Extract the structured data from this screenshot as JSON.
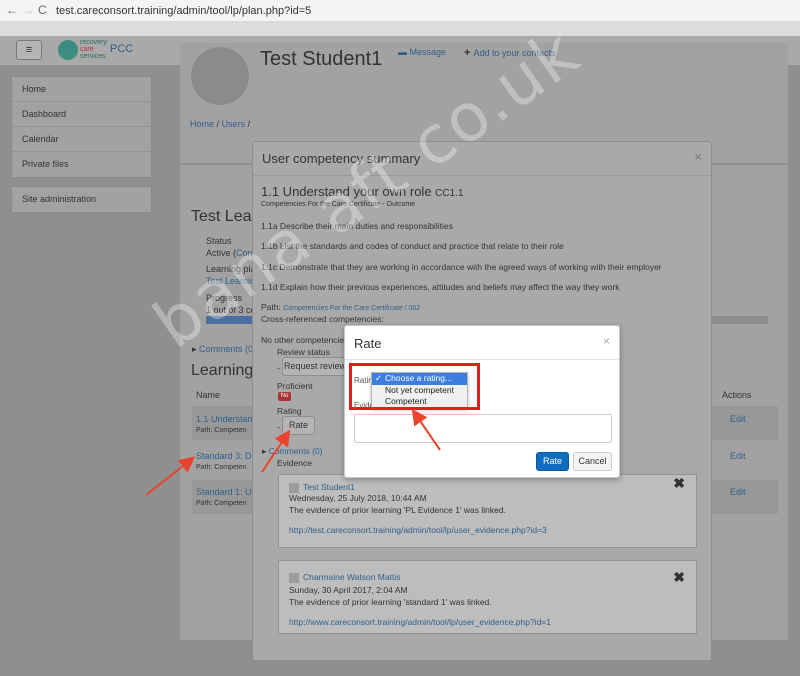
{
  "browser": {
    "back": "←",
    "forward": "→",
    "reload": "C",
    "url": "test.careconsort.training/admin/tool/lp/plan.php?id=5"
  },
  "navbar": {
    "menu_icon": "≡",
    "logo_line1": "recovery",
    "logo_line2": "care",
    "logo_line3": "services",
    "site_name": "PCC"
  },
  "sidebar": {
    "items": [
      "Home",
      "Dashboard",
      "Calendar",
      "Private files"
    ],
    "admin": "Site administration"
  },
  "header": {
    "student_name": "Test Student1",
    "message_link": "Message",
    "add_contacts_link": "Add to your contacts",
    "breadcrumb_home": "Home",
    "breadcrumb_sep": "/",
    "breadcrumb_users": "Users",
    "breadcrumb_sep2": "/"
  },
  "plan": {
    "title": "Test Lea",
    "status_label": "Status",
    "status_value": "Active (",
    "status_link": "Comp",
    "learning_plan_label": "Learning pla",
    "learning_plan_value": "Test Learning",
    "progress_label": "Progress",
    "progress_value": "1 out of 3 co",
    "comments_link": "Comments (0)",
    "section_title": "Learning p",
    "name_header": "Name",
    "actions_header": "Actions",
    "rows": [
      {
        "name": "1.1 Understand",
        "path": "Path: Competen",
        "action": "Edit"
      },
      {
        "name": "Standard 3: Du",
        "path": "Path: Competen",
        "action": "Edit"
      },
      {
        "name": "Standard 1: Un",
        "path": "Path: Competen",
        "action": "Edit"
      }
    ]
  },
  "summary": {
    "title": "User competency summary",
    "close": "×",
    "competency_title": "1.1 Understand your own role",
    "competency_code": "CC1.1",
    "framework_line": "Competencies For the Care Certificate - Outcome",
    "outcomes": [
      "1.1a Describe their main duties and responsibilities",
      "1.1b List the standards and codes of conduct and practice that relate to their role",
      "1.1c Demonstrate that they are working in accordance with the agreed ways of working with their employer",
      "1.1d Explain how their previous experiences, attitudes and beliefs may affect the way they work"
    ],
    "path_label": "Path:",
    "path_link": "Competencies For the Care Certificate",
    "path_sep": " / ",
    "path_tail": "002",
    "cross_ref_label": "Cross-referenced competencies:",
    "no_other": "No other competencies",
    "review_status_label": "Review status",
    "review_dash": "-",
    "request_review_button": "Request review",
    "proficient_label": "Proficient",
    "proficient_value": "No",
    "rating_label": "Rating",
    "rating_dash": "-",
    "rate_button": "Rate",
    "comments_link": "Comments (0)",
    "evidence_label": "Evidence",
    "evidence": [
      {
        "author": "Test Student1",
        "date": "Wednesday, 25 July 2018, 10:44 AM",
        "text": "The evidence of prior learning 'PL Evidence 1' was linked.",
        "link": "http://test.careconsort.training/admin/tool/lp/user_evidence.php?id=3",
        "remove": "✖"
      },
      {
        "author": "Charmaine Watson Mattis",
        "date": "Sunday, 30 April 2017, 2:04 AM",
        "text": "The evidence of prior learning 'standard 1' was linked.",
        "link": "http://www.careconsort.training/admin/tool/lp/user_evidence.php?id=1",
        "remove": "✖"
      }
    ]
  },
  "rate_dialog": {
    "title": "Rate",
    "close": "×",
    "rating_label": "Ratin",
    "evidence_label": "Evide",
    "evidence_value": "",
    "rate_button": "Rate",
    "cancel_button": "Cancel",
    "check": "✓",
    "options": [
      {
        "label": "Choose a rating...",
        "selected": true
      },
      {
        "label": "Not yet competent",
        "selected": false
      },
      {
        "label": "Competent",
        "selected": false
      }
    ]
  },
  "watermark": "bana aft co.uk",
  "colors": {
    "accent": "#0f6cbf",
    "highlight": "#e01e1e",
    "badge": "#aa3333"
  }
}
